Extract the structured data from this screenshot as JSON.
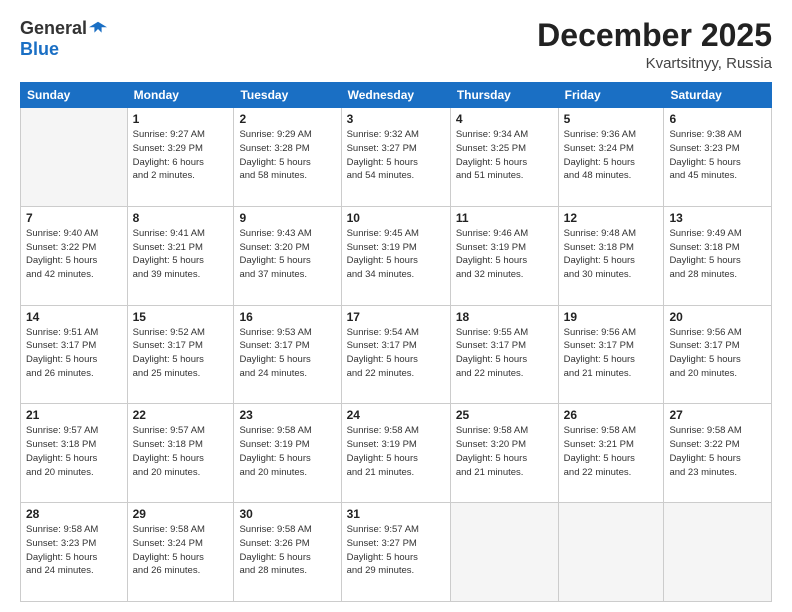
{
  "logo": {
    "general": "General",
    "blue": "Blue"
  },
  "title": "December 2025",
  "location": "Kvartsitnyy, Russia",
  "days_header": [
    "Sunday",
    "Monday",
    "Tuesday",
    "Wednesday",
    "Thursday",
    "Friday",
    "Saturday"
  ],
  "weeks": [
    [
      {
        "day": "",
        "info": ""
      },
      {
        "day": "1",
        "info": "Sunrise: 9:27 AM\nSunset: 3:29 PM\nDaylight: 6 hours\nand 2 minutes."
      },
      {
        "day": "2",
        "info": "Sunrise: 9:29 AM\nSunset: 3:28 PM\nDaylight: 5 hours\nand 58 minutes."
      },
      {
        "day": "3",
        "info": "Sunrise: 9:32 AM\nSunset: 3:27 PM\nDaylight: 5 hours\nand 54 minutes."
      },
      {
        "day": "4",
        "info": "Sunrise: 9:34 AM\nSunset: 3:25 PM\nDaylight: 5 hours\nand 51 minutes."
      },
      {
        "day": "5",
        "info": "Sunrise: 9:36 AM\nSunset: 3:24 PM\nDaylight: 5 hours\nand 48 minutes."
      },
      {
        "day": "6",
        "info": "Sunrise: 9:38 AM\nSunset: 3:23 PM\nDaylight: 5 hours\nand 45 minutes."
      }
    ],
    [
      {
        "day": "7",
        "info": "Sunrise: 9:40 AM\nSunset: 3:22 PM\nDaylight: 5 hours\nand 42 minutes."
      },
      {
        "day": "8",
        "info": "Sunrise: 9:41 AM\nSunset: 3:21 PM\nDaylight: 5 hours\nand 39 minutes."
      },
      {
        "day": "9",
        "info": "Sunrise: 9:43 AM\nSunset: 3:20 PM\nDaylight: 5 hours\nand 37 minutes."
      },
      {
        "day": "10",
        "info": "Sunrise: 9:45 AM\nSunset: 3:19 PM\nDaylight: 5 hours\nand 34 minutes."
      },
      {
        "day": "11",
        "info": "Sunrise: 9:46 AM\nSunset: 3:19 PM\nDaylight: 5 hours\nand 32 minutes."
      },
      {
        "day": "12",
        "info": "Sunrise: 9:48 AM\nSunset: 3:18 PM\nDaylight: 5 hours\nand 30 minutes."
      },
      {
        "day": "13",
        "info": "Sunrise: 9:49 AM\nSunset: 3:18 PM\nDaylight: 5 hours\nand 28 minutes."
      }
    ],
    [
      {
        "day": "14",
        "info": "Sunrise: 9:51 AM\nSunset: 3:17 PM\nDaylight: 5 hours\nand 26 minutes."
      },
      {
        "day": "15",
        "info": "Sunrise: 9:52 AM\nSunset: 3:17 PM\nDaylight: 5 hours\nand 25 minutes."
      },
      {
        "day": "16",
        "info": "Sunrise: 9:53 AM\nSunset: 3:17 PM\nDaylight: 5 hours\nand 24 minutes."
      },
      {
        "day": "17",
        "info": "Sunrise: 9:54 AM\nSunset: 3:17 PM\nDaylight: 5 hours\nand 22 minutes."
      },
      {
        "day": "18",
        "info": "Sunrise: 9:55 AM\nSunset: 3:17 PM\nDaylight: 5 hours\nand 22 minutes."
      },
      {
        "day": "19",
        "info": "Sunrise: 9:56 AM\nSunset: 3:17 PM\nDaylight: 5 hours\nand 21 minutes."
      },
      {
        "day": "20",
        "info": "Sunrise: 9:56 AM\nSunset: 3:17 PM\nDaylight: 5 hours\nand 20 minutes."
      }
    ],
    [
      {
        "day": "21",
        "info": "Sunrise: 9:57 AM\nSunset: 3:18 PM\nDaylight: 5 hours\nand 20 minutes."
      },
      {
        "day": "22",
        "info": "Sunrise: 9:57 AM\nSunset: 3:18 PM\nDaylight: 5 hours\nand 20 minutes."
      },
      {
        "day": "23",
        "info": "Sunrise: 9:58 AM\nSunset: 3:19 PM\nDaylight: 5 hours\nand 20 minutes."
      },
      {
        "day": "24",
        "info": "Sunrise: 9:58 AM\nSunset: 3:19 PM\nDaylight: 5 hours\nand 21 minutes."
      },
      {
        "day": "25",
        "info": "Sunrise: 9:58 AM\nSunset: 3:20 PM\nDaylight: 5 hours\nand 21 minutes."
      },
      {
        "day": "26",
        "info": "Sunrise: 9:58 AM\nSunset: 3:21 PM\nDaylight: 5 hours\nand 22 minutes."
      },
      {
        "day": "27",
        "info": "Sunrise: 9:58 AM\nSunset: 3:22 PM\nDaylight: 5 hours\nand 23 minutes."
      }
    ],
    [
      {
        "day": "28",
        "info": "Sunrise: 9:58 AM\nSunset: 3:23 PM\nDaylight: 5 hours\nand 24 minutes."
      },
      {
        "day": "29",
        "info": "Sunrise: 9:58 AM\nSunset: 3:24 PM\nDaylight: 5 hours\nand 26 minutes."
      },
      {
        "day": "30",
        "info": "Sunrise: 9:58 AM\nSunset: 3:26 PM\nDaylight: 5 hours\nand 28 minutes."
      },
      {
        "day": "31",
        "info": "Sunrise: 9:57 AM\nSunset: 3:27 PM\nDaylight: 5 hours\nand 29 minutes."
      },
      {
        "day": "",
        "info": ""
      },
      {
        "day": "",
        "info": ""
      },
      {
        "day": "",
        "info": ""
      }
    ]
  ]
}
